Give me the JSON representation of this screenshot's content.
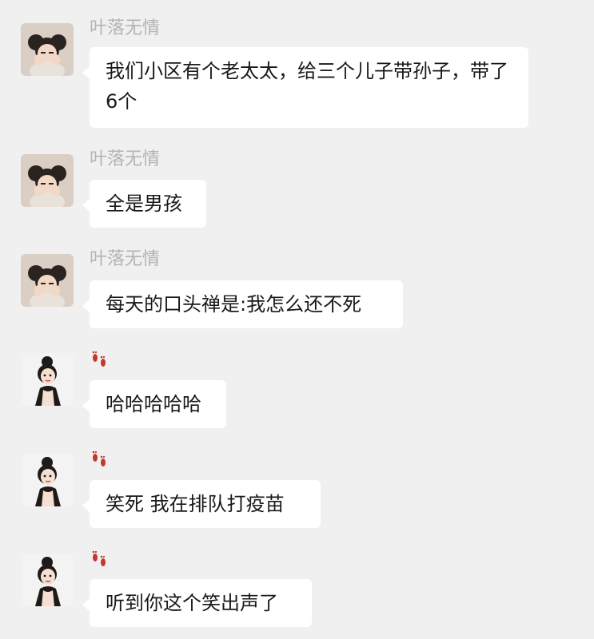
{
  "messages": [
    {
      "sender": "叶落无情",
      "text": "我们小区有个老太太，给三个儿子带孙子，带了6个"
    },
    {
      "sender": "叶落无情",
      "text": "全是男孩"
    },
    {
      "sender": "叶落无情",
      "text": "每天的口头禅是:我怎么还不死"
    },
    {
      "sender_icon": "footprints-icon",
      "text": "哈哈哈哈哈"
    },
    {
      "sender_icon": "footprints-icon",
      "text": "笑死 我在排队打疫苗"
    },
    {
      "sender_icon": "footprints-icon",
      "text": "听到你这个笑出声了"
    }
  ],
  "colors": {
    "background": "#f0f0f0",
    "bubble": "#ffffff",
    "sender_name": "#b3b3b3",
    "footprints": "#c0392b"
  }
}
